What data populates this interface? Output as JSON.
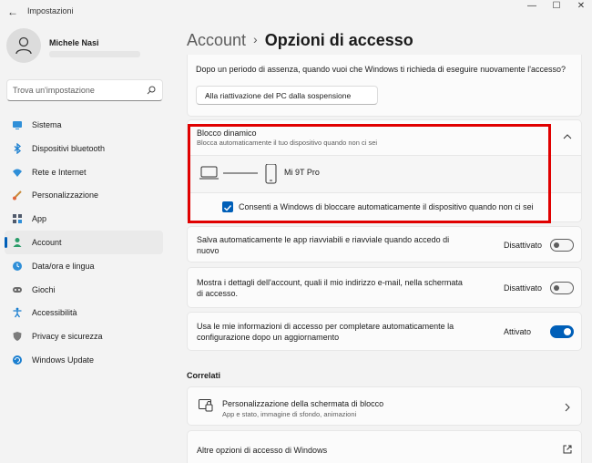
{
  "window": {
    "title": "Impostazioni"
  },
  "user": {
    "name": "Michele Nasi"
  },
  "search": {
    "placeholder": "Trova un'impostazione"
  },
  "sidebar": {
    "items": [
      {
        "label": "Sistema",
        "icon": "monitor-icon"
      },
      {
        "label": "Dispositivi bluetooth",
        "icon": "bluetooth-icon"
      },
      {
        "label": "Rete e Internet",
        "icon": "wifi-icon"
      },
      {
        "label": "Personalizzazione",
        "icon": "brush-icon"
      },
      {
        "label": "App",
        "icon": "apps-icon"
      },
      {
        "label": "Account",
        "icon": "person-icon",
        "active": true
      },
      {
        "label": "Data/ora e lingua",
        "icon": "globe-clock-icon"
      },
      {
        "label": "Giochi",
        "icon": "gamepad-icon"
      },
      {
        "label": "Accessibilità",
        "icon": "accessibility-icon"
      },
      {
        "label": "Privacy e sicurezza",
        "icon": "shield-icon"
      },
      {
        "label": "Windows Update",
        "icon": "update-icon"
      }
    ]
  },
  "breadcrumb": {
    "parent": "Account",
    "separator": "›",
    "current": "Opzioni di accesso"
  },
  "away": {
    "question": "Dopo un periodo di assenza, quando vuoi che Windows ti richieda di eseguire nuovamente l'accesso?",
    "dropdown_value": "Alla riattivazione del PC dalla sospensione"
  },
  "dynamic_lock": {
    "title": "Blocco dinamico",
    "description": "Blocca automaticamente il tuo dispositivo quando non ci sei",
    "device_name": "Mi 9T Pro",
    "checkbox_label": "Consenti a Windows di bloccare automaticamente il dispositivo quando non ci sei",
    "checked": true
  },
  "settings": [
    {
      "line1": "Salva automaticamente le app riavviabili e riavviale quando accedo di",
      "line2": "nuovo",
      "state": "Disattivato",
      "on": false
    },
    {
      "line1": "Mostra i dettagli dell'account, quali il mio indirizzo e-mail, nella schermata",
      "line2": "di accesso.",
      "state": "Disattivato",
      "on": false
    },
    {
      "line1": "Usa le mie informazioni di accesso per completare automaticamente la",
      "line2": "configurazione dopo un aggiornamento",
      "state": "Attivato",
      "on": true
    }
  ],
  "related": {
    "title": "Correlati",
    "lock_screen": {
      "title": "Personalizzazione della schermata di blocco",
      "subtitle": "App e stato, immagine di sfondo, animazioni"
    },
    "more": {
      "title": "Altre opzioni di accesso di Windows"
    }
  },
  "colors": {
    "accent": "#005fb8",
    "highlight": "#e00000",
    "background": "#f3f3f3",
    "card": "#fbfbfb"
  }
}
